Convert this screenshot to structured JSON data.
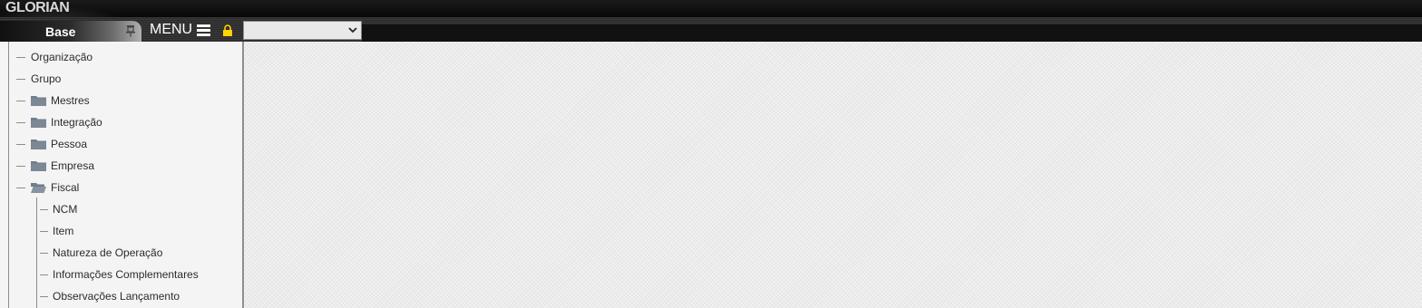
{
  "app": {
    "logo": "GLORIAN"
  },
  "toolbar": {
    "base_label": "Base",
    "menu_label": "MENU",
    "select_value": "",
    "colors": {
      "lock": "#ffd200",
      "bar": "#2b2b2b"
    }
  },
  "sidebar": {
    "items": [
      {
        "label": "Organização",
        "type": "leaf"
      },
      {
        "label": "Grupo",
        "type": "leaf"
      },
      {
        "label": "Mestres",
        "type": "folder-closed"
      },
      {
        "label": "Integração",
        "type": "folder-closed"
      },
      {
        "label": "Pessoa",
        "type": "folder-closed"
      },
      {
        "label": "Empresa",
        "type": "folder-closed"
      },
      {
        "label": "Fiscal",
        "type": "folder-open"
      }
    ],
    "fiscal_children": [
      {
        "label": "NCM"
      },
      {
        "label": "Item"
      },
      {
        "label": "Natureza de Operação"
      },
      {
        "label": "Informações Complementares"
      },
      {
        "label": "Observações Lançamento"
      }
    ]
  }
}
